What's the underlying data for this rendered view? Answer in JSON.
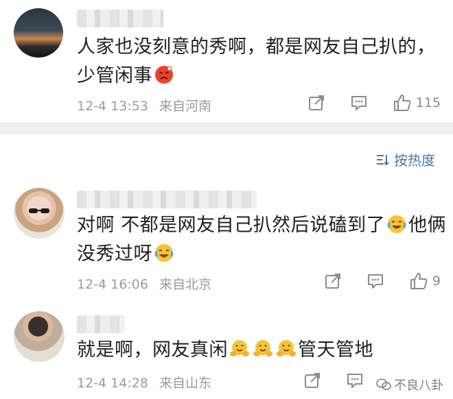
{
  "comments": [
    {
      "text_line1": "人家也没刻意的秀啊，都是网友自己扒的，",
      "text_line2": "少管闲事",
      "date": "12-4 13:53",
      "location": "来自河南",
      "likes": "115"
    },
    {
      "text_line1": "对啊 不都是网友自己扒然后说磕到了",
      "text_line1_tail": "他俩",
      "text_line2": "没秀过呀",
      "date": "12-4 16:06",
      "location": "来自北京",
      "likes": "9"
    },
    {
      "text_line1": "就是啊，网友真闲",
      "text_line1_tail": "管天管地",
      "date": "12-4 14:28",
      "location": "来自山东",
      "likes": ""
    }
  ],
  "sort": {
    "label": "按热度"
  },
  "watermark": {
    "text": "不良八卦"
  },
  "icons": {
    "share": "share-icon",
    "comment": "comment-icon",
    "like": "thumbs-up-icon",
    "sort": "sort-icon",
    "angry": "angry-face-emoji",
    "laugh": "laugh-cry-emoji",
    "hug": "hug-emoji"
  },
  "colors": {
    "link_blue": "#4a76a8",
    "meta_gray": "#9a9a9a",
    "divider": "#efefef"
  }
}
